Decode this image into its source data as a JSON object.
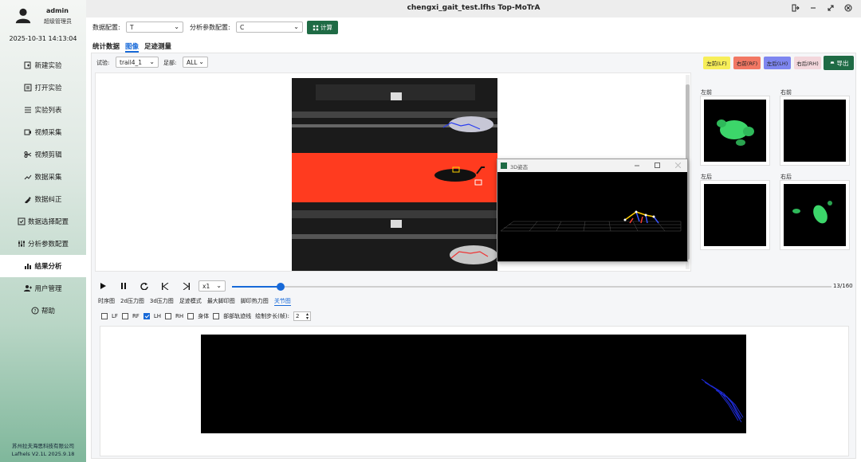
{
  "window": {
    "title": "chengxi_gait_test.lfhs Top-MoTrA"
  },
  "user": {
    "name": "admin",
    "role": "超级管理员"
  },
  "clock": "2025-10-31 14:13:04",
  "nav": [
    {
      "label": "新建实验",
      "icon": "new-file-icon"
    },
    {
      "label": "打开实验",
      "icon": "open-file-icon"
    },
    {
      "label": "实验列表",
      "icon": "list-icon"
    },
    {
      "label": "视频采集",
      "icon": "video-icon"
    },
    {
      "label": "视频剪辑",
      "icon": "scissors-icon"
    },
    {
      "label": "数据采集",
      "icon": "data-icon"
    },
    {
      "label": "数据纠正",
      "icon": "correct-icon"
    },
    {
      "label": "数据选择配置",
      "icon": "select-config-icon"
    },
    {
      "label": "分析参数配置",
      "icon": "sliders-icon"
    },
    {
      "label": "结果分析",
      "icon": "bar-chart-icon",
      "active": true
    },
    {
      "label": "用户管理",
      "icon": "user-icon"
    },
    {
      "label": "帮助",
      "icon": "help-icon"
    }
  ],
  "company": {
    "name": "苏州拉夫海思科技有限公司",
    "version": "Lafhels V2.1L 2025.9.18"
  },
  "config": {
    "data_label": "数据配置:",
    "data_value": "T",
    "analysis_label": "分析参数配置:",
    "analysis_value": "C",
    "calc_label": "计算"
  },
  "tabs": [
    "统计数据",
    "图像",
    "足迹测量"
  ],
  "active_tab": 1,
  "filter": {
    "trial_label": "试验:",
    "trial_value": "trail4_1",
    "foot_label": "足部:",
    "foot_value": "ALL"
  },
  "paw_buttons": [
    {
      "label": "左前(LF)",
      "color": "#f7ee59"
    },
    {
      "label": "右前(RF)",
      "color": "#f27864"
    },
    {
      "label": "左后(LH)",
      "color": "#7e86f0"
    },
    {
      "label": "右后(RH)",
      "color": "#f3d7dc"
    }
  ],
  "export_label": "导出",
  "popup": {
    "title": "3D姿态"
  },
  "footprints": [
    {
      "label": "左前"
    },
    {
      "label": "右前"
    },
    {
      "label": "左后"
    },
    {
      "label": "右后"
    }
  ],
  "playback": {
    "speed": "x1",
    "frame": "13/160",
    "current": 13,
    "total": 160
  },
  "subtabs": [
    "时序图",
    "2d压力图",
    "3d压力图",
    "足迹模式",
    "最大脚印图",
    "脚印热力图",
    "关节图"
  ],
  "active_subtab": 6,
  "checks": [
    {
      "label": "LF",
      "on": false
    },
    {
      "label": "RF",
      "on": false
    },
    {
      "label": "LH",
      "on": true
    },
    {
      "label": "RH",
      "on": false
    },
    {
      "label": "身体",
      "on": false
    },
    {
      "label": "部部轨迹线",
      "on": false
    }
  ],
  "step": {
    "label": "绘制步长(帧):",
    "value": "2"
  },
  "colors": {
    "accent": "#1769d8",
    "green": "#1f6b45"
  }
}
